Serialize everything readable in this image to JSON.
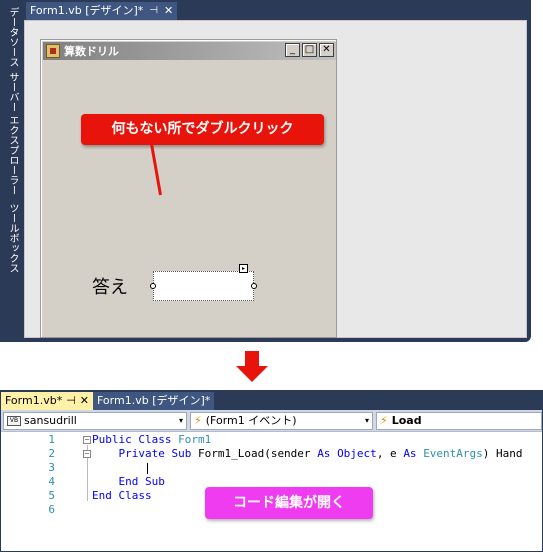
{
  "designer": {
    "side_tabs": [
      "データソース",
      "サーバー エクスプローラー",
      "ツールボックス"
    ],
    "doc_tab": {
      "title": "Form1.vb [デザイン]*",
      "pin": "⊣",
      "close": "✕"
    },
    "form": {
      "title": "算数ドリル",
      "btn_min": "_",
      "btn_max": "□",
      "btn_close": "✕",
      "answer_label": "答え",
      "smart_tag": "▸"
    },
    "callout": "何もない所でダブルクリック"
  },
  "editor": {
    "tabs": [
      {
        "title": "Form1.vb*",
        "pin": "⊣",
        "close": "✕"
      },
      {
        "title": "Form1.vb [デザイン]*"
      }
    ],
    "nav": {
      "project": "sansudrill",
      "object": "(Form1 イベント)",
      "event": "Load",
      "vb_badge": "VB",
      "dropdown": "▾",
      "bolt": "⚡"
    },
    "lines": [
      {
        "n": "1",
        "fold": "−",
        "parts": [
          {
            "t": "Public Class ",
            "c": "kw"
          },
          {
            "t": "Form1",
            "c": "ty"
          }
        ]
      },
      {
        "n": "2",
        "fold": "−",
        "parts": [
          {
            "t": "    Private Sub ",
            "c": "kw"
          },
          {
            "t": "Form1_Load(sender ",
            "c": ""
          },
          {
            "t": "As ",
            "c": "kw"
          },
          {
            "t": "Object",
            "c": "kw"
          },
          {
            "t": ", e ",
            "c": ""
          },
          {
            "t": "As ",
            "c": "kw"
          },
          {
            "t": "EventArgs",
            "c": "ty"
          },
          {
            "t": ") Hand",
            "c": ""
          }
        ]
      },
      {
        "n": "3",
        "fold": "",
        "parts": [
          {
            "t": "",
            "c": ""
          }
        ]
      },
      {
        "n": "4",
        "fold": "",
        "parts": [
          {
            "t": "    End Sub",
            "c": "kw"
          }
        ]
      },
      {
        "n": "5",
        "fold": "",
        "parts": [
          {
            "t": "End Class",
            "c": "kw"
          }
        ]
      },
      {
        "n": "6",
        "fold": "",
        "parts": [
          {
            "t": "",
            "c": ""
          }
        ]
      }
    ],
    "callout": "コード編集が開く"
  },
  "colors": {
    "accent_red": "#e8140c",
    "accent_pink": "#f03cf0",
    "chrome_navy": "#2b3a56",
    "keyword_blue": "#0000ff",
    "type_teal": "#2b91af"
  }
}
